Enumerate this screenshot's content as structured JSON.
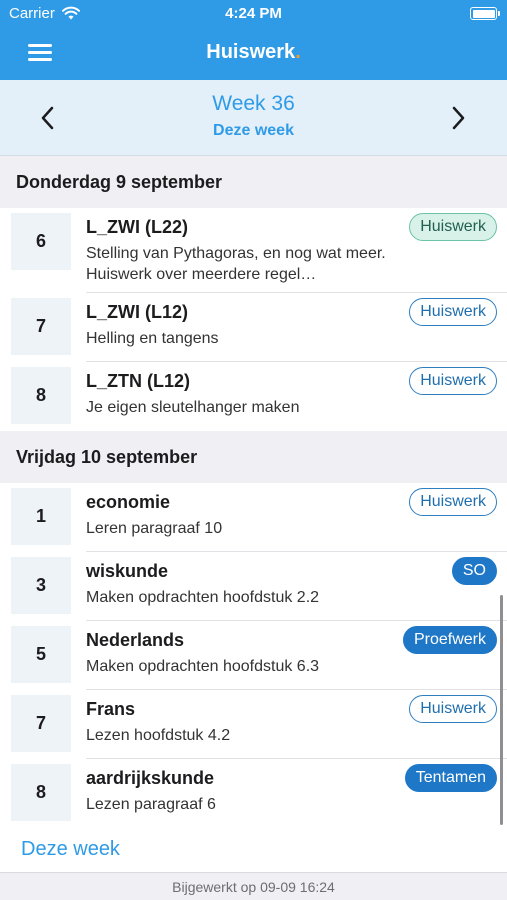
{
  "status_bar": {
    "carrier": "Carrier",
    "time": "4:24 PM"
  },
  "nav": {
    "title": "Huiswerk",
    "title_dot": ".",
    "accent": "#2f9be6",
    "dot_color": "#f59b2b"
  },
  "week": {
    "title": "Week 36",
    "subtitle": "Deze week"
  },
  "days": [
    {
      "header": "Donderdag 9 september",
      "items": [
        {
          "hour": "6",
          "subject": "L_ZWI (L22)",
          "description": "Stelling van Pythagoras, en nog wat meer. Huiswerk over meerdere regel…",
          "badge": "Huiswerk",
          "badge_style": "green"
        },
        {
          "hour": "7",
          "subject": "L_ZWI (L12)",
          "description": "Helling en tangens",
          "badge": "Huiswerk",
          "badge_style": "outline"
        },
        {
          "hour": "8",
          "subject": "L_ZTN (L12)",
          "description": "Je eigen sleutelhanger maken",
          "badge": "Huiswerk",
          "badge_style": "outline"
        }
      ]
    },
    {
      "header": "Vrijdag 10 september",
      "items": [
        {
          "hour": "1",
          "subject": "economie",
          "description": "Leren paragraaf 10",
          "badge": "Huiswerk",
          "badge_style": "outline"
        },
        {
          "hour": "3",
          "subject": "wiskunde",
          "description": "Maken opdrachten hoofdstuk 2.2",
          "badge": "SO",
          "badge_style": "filled"
        },
        {
          "hour": "5",
          "subject": "Nederlands",
          "description": "Maken opdrachten hoofdstuk 6.3",
          "badge": "Proefwerk",
          "badge_style": "filled"
        },
        {
          "hour": "7",
          "subject": "Frans",
          "description": "Lezen hoofdstuk 4.2",
          "badge": "Huiswerk",
          "badge_style": "outline"
        },
        {
          "hour": "8",
          "subject": "aardrijkskunde",
          "description": "Lezen paragraaf 6",
          "badge": "Tentamen",
          "badge_style": "filled"
        }
      ]
    }
  ],
  "footer": {
    "link": "Deze week",
    "updated": "Bijgewerkt op 09-09 16:24"
  }
}
